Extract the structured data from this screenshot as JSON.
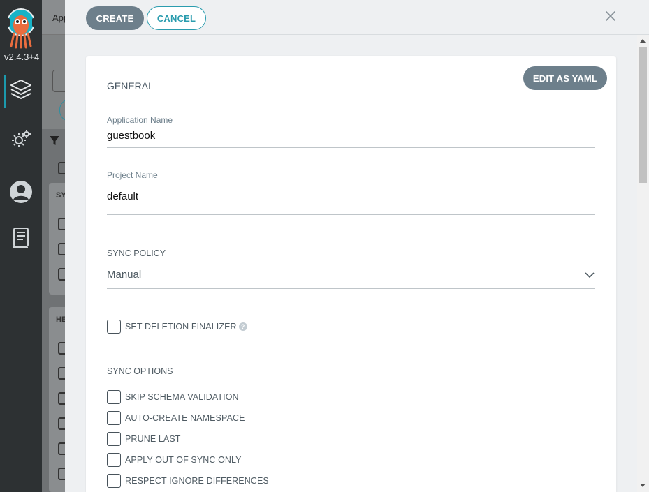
{
  "nav": {
    "version": "v2.4.3+4",
    "items": [
      {
        "name": "applications",
        "icon": "layers-icon"
      },
      {
        "name": "settings",
        "icon": "gear-icon"
      },
      {
        "name": "user-info",
        "icon": "user-icon"
      },
      {
        "name": "documentation",
        "icon": "docs-icon"
      }
    ]
  },
  "background": {
    "title": "App",
    "filter_sections": [
      "SY",
      "HE"
    ]
  },
  "header": {
    "create_label": "CREATE",
    "cancel_label": "CANCEL"
  },
  "form": {
    "edit_yaml_label": "EDIT AS YAML",
    "general_title": "GENERAL",
    "app_name_label": "Application Name",
    "app_name_value": "guestbook",
    "project_label": "Project Name",
    "project_value": "default",
    "sync_policy_label": "SYNC POLICY",
    "sync_policy_value": "Manual",
    "deletion_finalizer_label": "SET DELETION FINALIZER",
    "sync_options_title": "SYNC OPTIONS",
    "sync_options": [
      "SKIP SCHEMA VALIDATION",
      "AUTO-CREATE NAMESPACE",
      "PRUNE LAST",
      "APPLY OUT OF SYNC ONLY",
      "RESPECT IGNORE DIFFERENCES"
    ]
  },
  "colors": {
    "accent": "#2a9cae",
    "primary_button": "#6d7f8b",
    "nav_bg": "#2d3133"
  }
}
